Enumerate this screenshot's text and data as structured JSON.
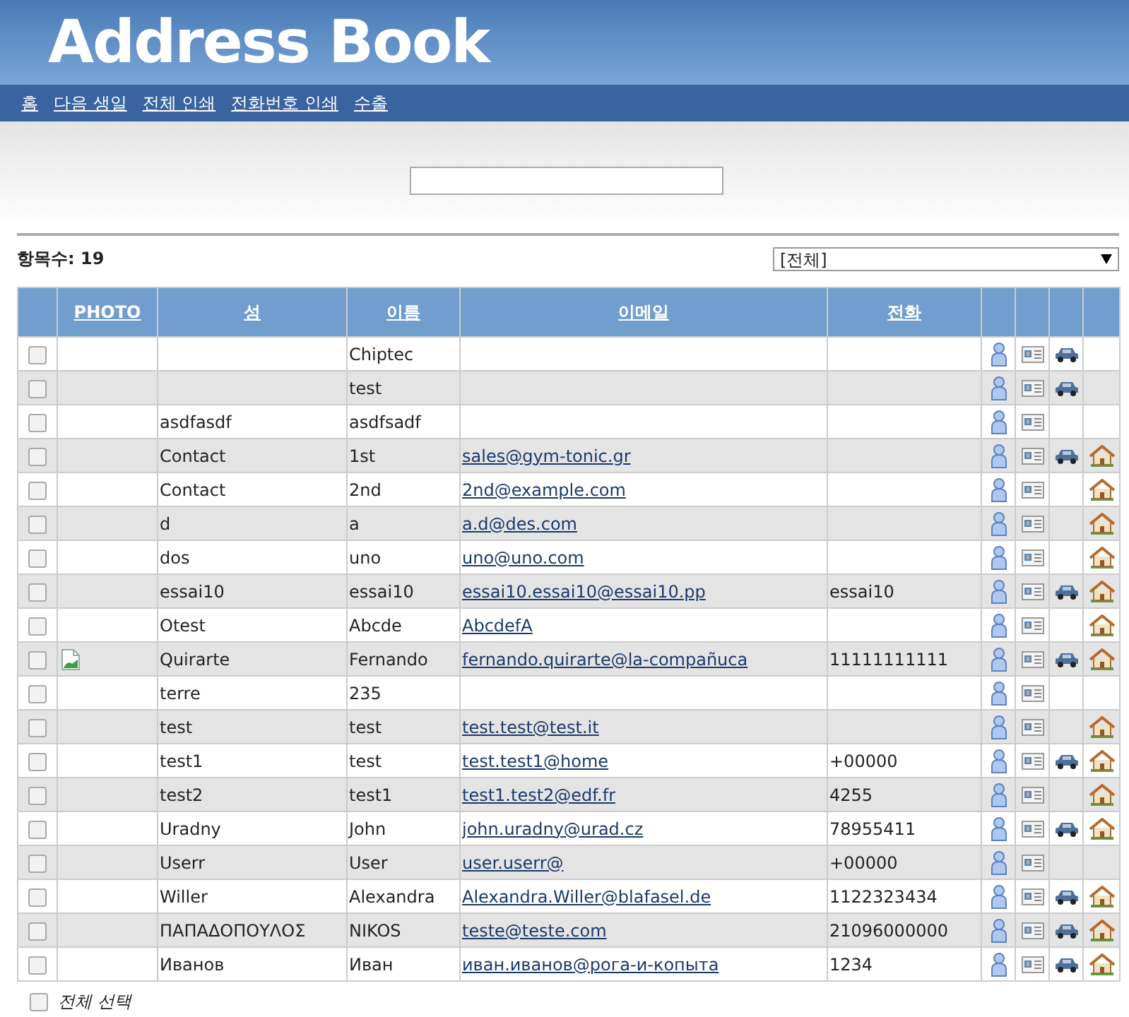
{
  "header": {
    "title": "Address Book"
  },
  "nav": [
    "홈",
    "다음 생일",
    "전체 인쇄",
    "전화번호 인쇄",
    "수출"
  ],
  "count": {
    "label": "항목수:",
    "value": "19"
  },
  "group_select": {
    "value": "[전체]"
  },
  "table": {
    "columns": [
      "PHOTO",
      "성",
      "이름",
      "이메일",
      "전화"
    ],
    "rows": [
      {
        "selected": false,
        "photo": false,
        "last": "",
        "first": "Chiptec",
        "email": "",
        "phone": "",
        "car": true,
        "home": false
      },
      {
        "selected": false,
        "photo": false,
        "last": "",
        "first": "test",
        "email": "",
        "phone": "",
        "car": true,
        "home": false
      },
      {
        "selected": false,
        "photo": false,
        "last": "asdfasdf",
        "first": "asdfsadf",
        "email": "",
        "phone": "",
        "car": false,
        "home": false
      },
      {
        "selected": false,
        "photo": false,
        "last": "Contact",
        "first": "1st",
        "email": "sales@gym-tonic.gr",
        "phone": "",
        "car": true,
        "home": true
      },
      {
        "selected": false,
        "photo": false,
        "last": "Contact",
        "first": "2nd",
        "email": "2nd@example.com",
        "phone": "",
        "car": false,
        "home": true
      },
      {
        "selected": false,
        "photo": false,
        "last": "d",
        "first": "a",
        "email": "a.d@des.com",
        "phone": "",
        "car": false,
        "home": true
      },
      {
        "selected": false,
        "photo": false,
        "last": "dos",
        "first": "uno",
        "email": "uno@uno.com",
        "phone": "",
        "car": false,
        "home": true
      },
      {
        "selected": false,
        "photo": false,
        "last": "essai10",
        "first": "essai10",
        "email": "essai10.essai10@essai10.pp",
        "phone": "essai10",
        "car": true,
        "home": true
      },
      {
        "selected": false,
        "photo": false,
        "last": "Otest",
        "first": "Abcde",
        "email": "AbcdefA",
        "phone": "",
        "car": false,
        "home": true
      },
      {
        "selected": false,
        "photo": true,
        "last": "Quirarte",
        "first": "Fernando",
        "email": "fernando.quirarte@la-compañuca",
        "phone": "11111111111",
        "car": true,
        "home": true
      },
      {
        "selected": false,
        "photo": false,
        "last": "terre",
        "first": "235",
        "email": "",
        "phone": "",
        "car": false,
        "home": false
      },
      {
        "selected": false,
        "photo": false,
        "last": "test",
        "first": "test",
        "email": "test.test@test.it",
        "phone": "",
        "car": false,
        "home": true
      },
      {
        "selected": false,
        "photo": false,
        "last": "test1",
        "first": "test",
        "email": "test.test1@home",
        "phone": "+00000",
        "car": true,
        "home": true
      },
      {
        "selected": false,
        "photo": false,
        "last": "test2",
        "first": "test1",
        "email": "test1.test2@edf.fr",
        "phone": "4255",
        "car": false,
        "home": true
      },
      {
        "selected": false,
        "photo": false,
        "last": "Uradny",
        "first": "John",
        "email": "john.uradny@urad.cz",
        "phone": "78955411",
        "car": true,
        "home": true
      },
      {
        "selected": false,
        "photo": false,
        "last": "Userr",
        "first": "User",
        "email": "user.userr@",
        "phone": "+00000",
        "car": false,
        "home": false
      },
      {
        "selected": false,
        "photo": false,
        "last": "Willer",
        "first": "Alexandra",
        "email": "Alexandra.Willer@blafasel.de",
        "phone": "1122323434",
        "car": true,
        "home": true
      },
      {
        "selected": false,
        "photo": false,
        "last": "ΠΑΠΑΔΟΠΟΥΛΟΣ",
        "first": "NIKOS",
        "email": "teste@teste.com",
        "phone": "21096000000",
        "car": true,
        "home": true
      },
      {
        "selected": false,
        "photo": false,
        "last": "Иванов",
        "first": "Иван",
        "email": "иван.иванов@рога-и-копыта",
        "phone": "1234",
        "car": true,
        "home": true
      }
    ]
  },
  "select_all": {
    "label": "전체 선택",
    "checked": false
  }
}
